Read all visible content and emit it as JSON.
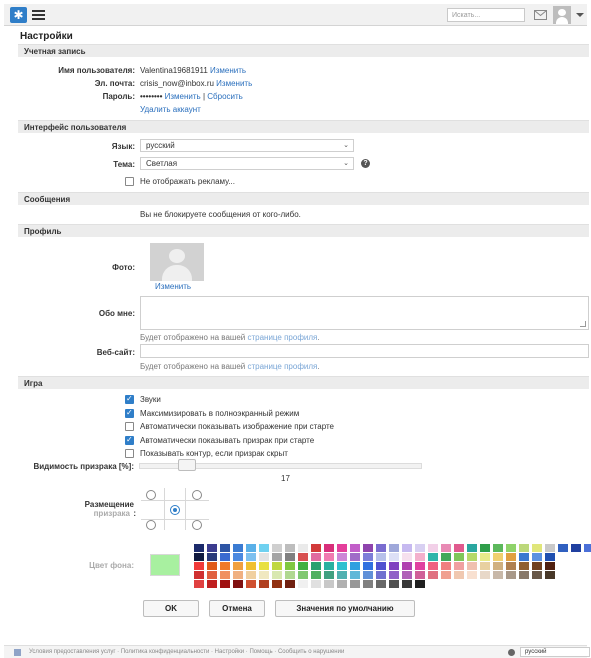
{
  "header": {
    "search_placeholder": "Искать..."
  },
  "page_title": "Настройки",
  "account": {
    "section": "Учетная запись",
    "username_label": "Имя пользователя:",
    "username": "Valentina19681911",
    "change_link": "Изменить",
    "email_label": "Эл. почта:",
    "email": "crisis_now@inbox.ru",
    "email_change": "Изменить",
    "password_label": "Пароль:",
    "password_mask": "••••••••",
    "password_change": "Изменить",
    "separator": "|",
    "password_reset": "Сбросить",
    "delete_link": "Удалить аккаунт"
  },
  "ui": {
    "section": "Интерфейс пользователя",
    "language_label": "Язык:",
    "language": "русский",
    "theme_label": "Тема:",
    "theme": "Светлая",
    "no_ads": "Не отображать рекламу..."
  },
  "messages": {
    "section": "Сообщения",
    "text": "Вы не блокируете сообщения от кого-либо."
  },
  "profile": {
    "section": "Профиль",
    "photo_label": "Фото:",
    "photo_change": "Изменить",
    "about_label": "Обо мне:",
    "about_hint_prefix": "Будет отображено на вашей",
    "about_hint_link": "странице профиля",
    "about_hint_suffix": ".",
    "website_label": "Веб-сайт:",
    "website_hint_prefix": "Будет отображено на вашей",
    "website_hint_link": "странице профиля",
    "website_hint_suffix": "."
  },
  "game": {
    "section": "Игра",
    "options": [
      {
        "label": "Звуки",
        "checked": true
      },
      {
        "label": "Максимизировать в полноэкранный режим",
        "checked": true
      },
      {
        "label": "Автоматически показывать изображение при старте",
        "checked": false
      },
      {
        "label": "Автоматически показывать призрак при старте",
        "checked": true
      },
      {
        "label": "Показывать контур, если призрак скрыт",
        "checked": false
      }
    ],
    "ghost_visibility_label": "Видимость призрака [%]:",
    "ghost_visibility_value": "17",
    "ghost_visibility_fraction": 0.17,
    "placement_label": "Размещение",
    "placement_sublabel": "призрака",
    "placement_colon": ":",
    "color_label": "Цвет фона:",
    "current_color": "#a8f0a0"
  },
  "buttons": {
    "ok": "OK",
    "cancel": "Отмена",
    "defaults": "Значения по умолчанию"
  },
  "footer": {
    "links": "Условия предоставления услуг · Политика конфиденциальности · Настройки · Помощь · Сообщить о нарушении",
    "language": "русский"
  }
}
